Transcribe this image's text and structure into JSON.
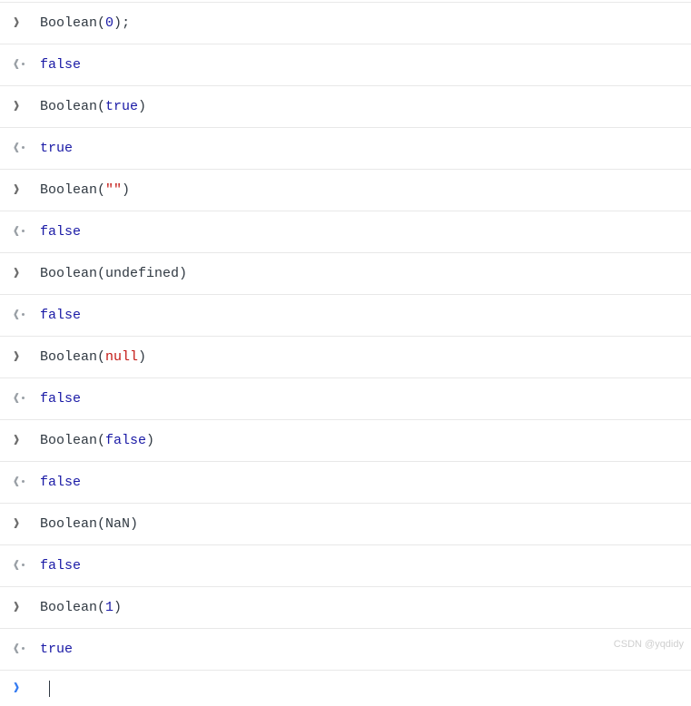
{
  "entries": [
    {
      "type": "input",
      "segments": [
        {
          "text": "Boolean",
          "cls": "fn"
        },
        {
          "text": "(",
          "cls": "fn"
        },
        {
          "text": "0",
          "cls": "num"
        },
        {
          "text": ")",
          "cls": "fn"
        },
        {
          "text": ";",
          "cls": "semi"
        }
      ]
    },
    {
      "type": "output",
      "segments": [
        {
          "text": "false",
          "cls": "result-bool"
        }
      ]
    },
    {
      "type": "input",
      "segments": [
        {
          "text": "Boolean",
          "cls": "fn"
        },
        {
          "text": "(",
          "cls": "fn"
        },
        {
          "text": "true",
          "cls": "boolkw"
        },
        {
          "text": ")",
          "cls": "fn"
        }
      ]
    },
    {
      "type": "output",
      "segments": [
        {
          "text": "true",
          "cls": "result-bool"
        }
      ]
    },
    {
      "type": "input",
      "segments": [
        {
          "text": "Boolean",
          "cls": "fn"
        },
        {
          "text": "(",
          "cls": "fn"
        },
        {
          "text": "\"\"",
          "cls": "str"
        },
        {
          "text": ")",
          "cls": "fn"
        }
      ]
    },
    {
      "type": "output",
      "segments": [
        {
          "text": "false",
          "cls": "result-bool"
        }
      ]
    },
    {
      "type": "input",
      "segments": [
        {
          "text": "Boolean",
          "cls": "fn"
        },
        {
          "text": "(",
          "cls": "fn"
        },
        {
          "text": "undefined",
          "cls": "undef"
        },
        {
          "text": ")",
          "cls": "fn"
        }
      ]
    },
    {
      "type": "output",
      "segments": [
        {
          "text": "false",
          "cls": "result-bool"
        }
      ]
    },
    {
      "type": "input",
      "segments": [
        {
          "text": "Boolean",
          "cls": "fn"
        },
        {
          "text": "(",
          "cls": "fn"
        },
        {
          "text": "null",
          "cls": "nullkw"
        },
        {
          "text": ")",
          "cls": "fn"
        }
      ]
    },
    {
      "type": "output",
      "segments": [
        {
          "text": "false",
          "cls": "result-bool"
        }
      ]
    },
    {
      "type": "input",
      "segments": [
        {
          "text": "Boolean",
          "cls": "fn"
        },
        {
          "text": "(",
          "cls": "fn"
        },
        {
          "text": "false",
          "cls": "falsekw"
        },
        {
          "text": ")",
          "cls": "fn"
        }
      ]
    },
    {
      "type": "output",
      "segments": [
        {
          "text": "false",
          "cls": "result-bool"
        }
      ]
    },
    {
      "type": "input",
      "segments": [
        {
          "text": "Boolean",
          "cls": "fn"
        },
        {
          "text": "(",
          "cls": "fn"
        },
        {
          "text": "NaN",
          "cls": "nan"
        },
        {
          "text": ")",
          "cls": "fn"
        }
      ]
    },
    {
      "type": "output",
      "segments": [
        {
          "text": "false",
          "cls": "result-bool"
        }
      ]
    },
    {
      "type": "input",
      "segments": [
        {
          "text": "Boolean",
          "cls": "fn"
        },
        {
          "text": "(",
          "cls": "fn"
        },
        {
          "text": "1",
          "cls": "num"
        },
        {
          "text": ")",
          "cls": "fn"
        }
      ]
    },
    {
      "type": "output",
      "segments": [
        {
          "text": "true",
          "cls": "result-bool"
        }
      ]
    }
  ],
  "watermark": "CSDN @yqdidy"
}
